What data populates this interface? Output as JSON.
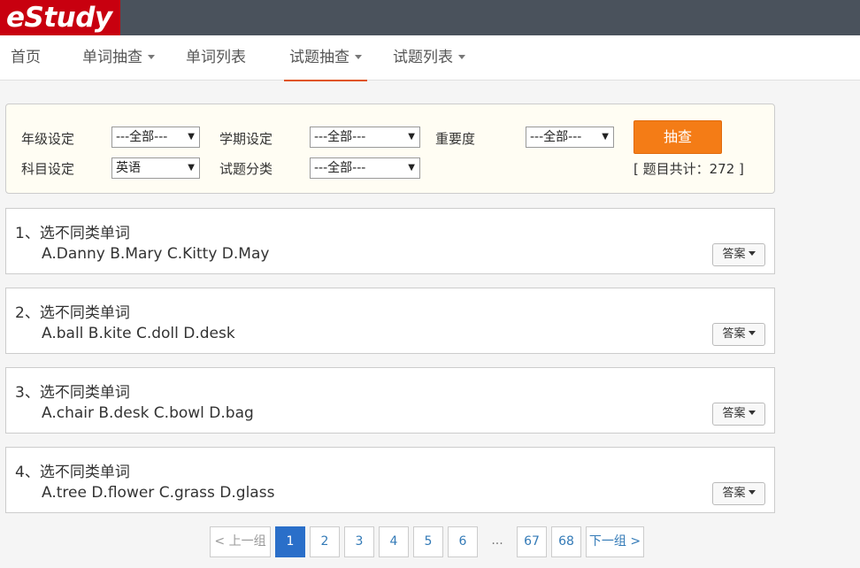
{
  "brand": {
    "logo_text": "eStudy"
  },
  "nav": {
    "items": [
      {
        "label": "首页",
        "has_dropdown": false
      },
      {
        "label": "单词抽查",
        "has_dropdown": true
      },
      {
        "label": "单词列表",
        "has_dropdown": false
      },
      {
        "label": "试题抽查",
        "has_dropdown": true,
        "active": true
      },
      {
        "label": "试题列表",
        "has_dropdown": true
      }
    ]
  },
  "filters": {
    "grade_label": "年级设定",
    "grade_value": "---全部---",
    "semester_label": "学期设定",
    "semester_value": "---全部---",
    "importance_label": "重要度",
    "importance_value": "---全部---",
    "subject_label": "科目设定",
    "subject_value": "英语",
    "category_label": "试题分类",
    "category_value": "---全部---",
    "draw_button": "抽查",
    "count_text": "[ 题目共计：272 ]"
  },
  "questions": [
    {
      "title": "1、选不同类单词",
      "options": "A.Danny B.Mary C.Kitty D.May",
      "answer_label": "答案"
    },
    {
      "title": "2、选不同类单词",
      "options": "A.ball B.kite C.doll D.desk",
      "answer_label": "答案"
    },
    {
      "title": "3、选不同类单词",
      "options": "A.chair B.desk C.bowl D.bag",
      "answer_label": "答案"
    },
    {
      "title": "4、选不同类单词",
      "options": "A.tree D.flower C.grass D.glass",
      "answer_label": "答案"
    }
  ],
  "pagination": {
    "prev": "< 上一组",
    "pages": [
      "1",
      "2",
      "3",
      "4",
      "5",
      "6"
    ],
    "ellipsis": "...",
    "tail_pages": [
      "67",
      "68"
    ],
    "next": "下一组 >",
    "current": "1"
  },
  "colors": {
    "topbar": "#4a525c",
    "logo_bg": "#c8000f",
    "nav_active_underline": "#e0541a",
    "draw_button": "#f47c16",
    "page_active": "#2a6fc9"
  }
}
